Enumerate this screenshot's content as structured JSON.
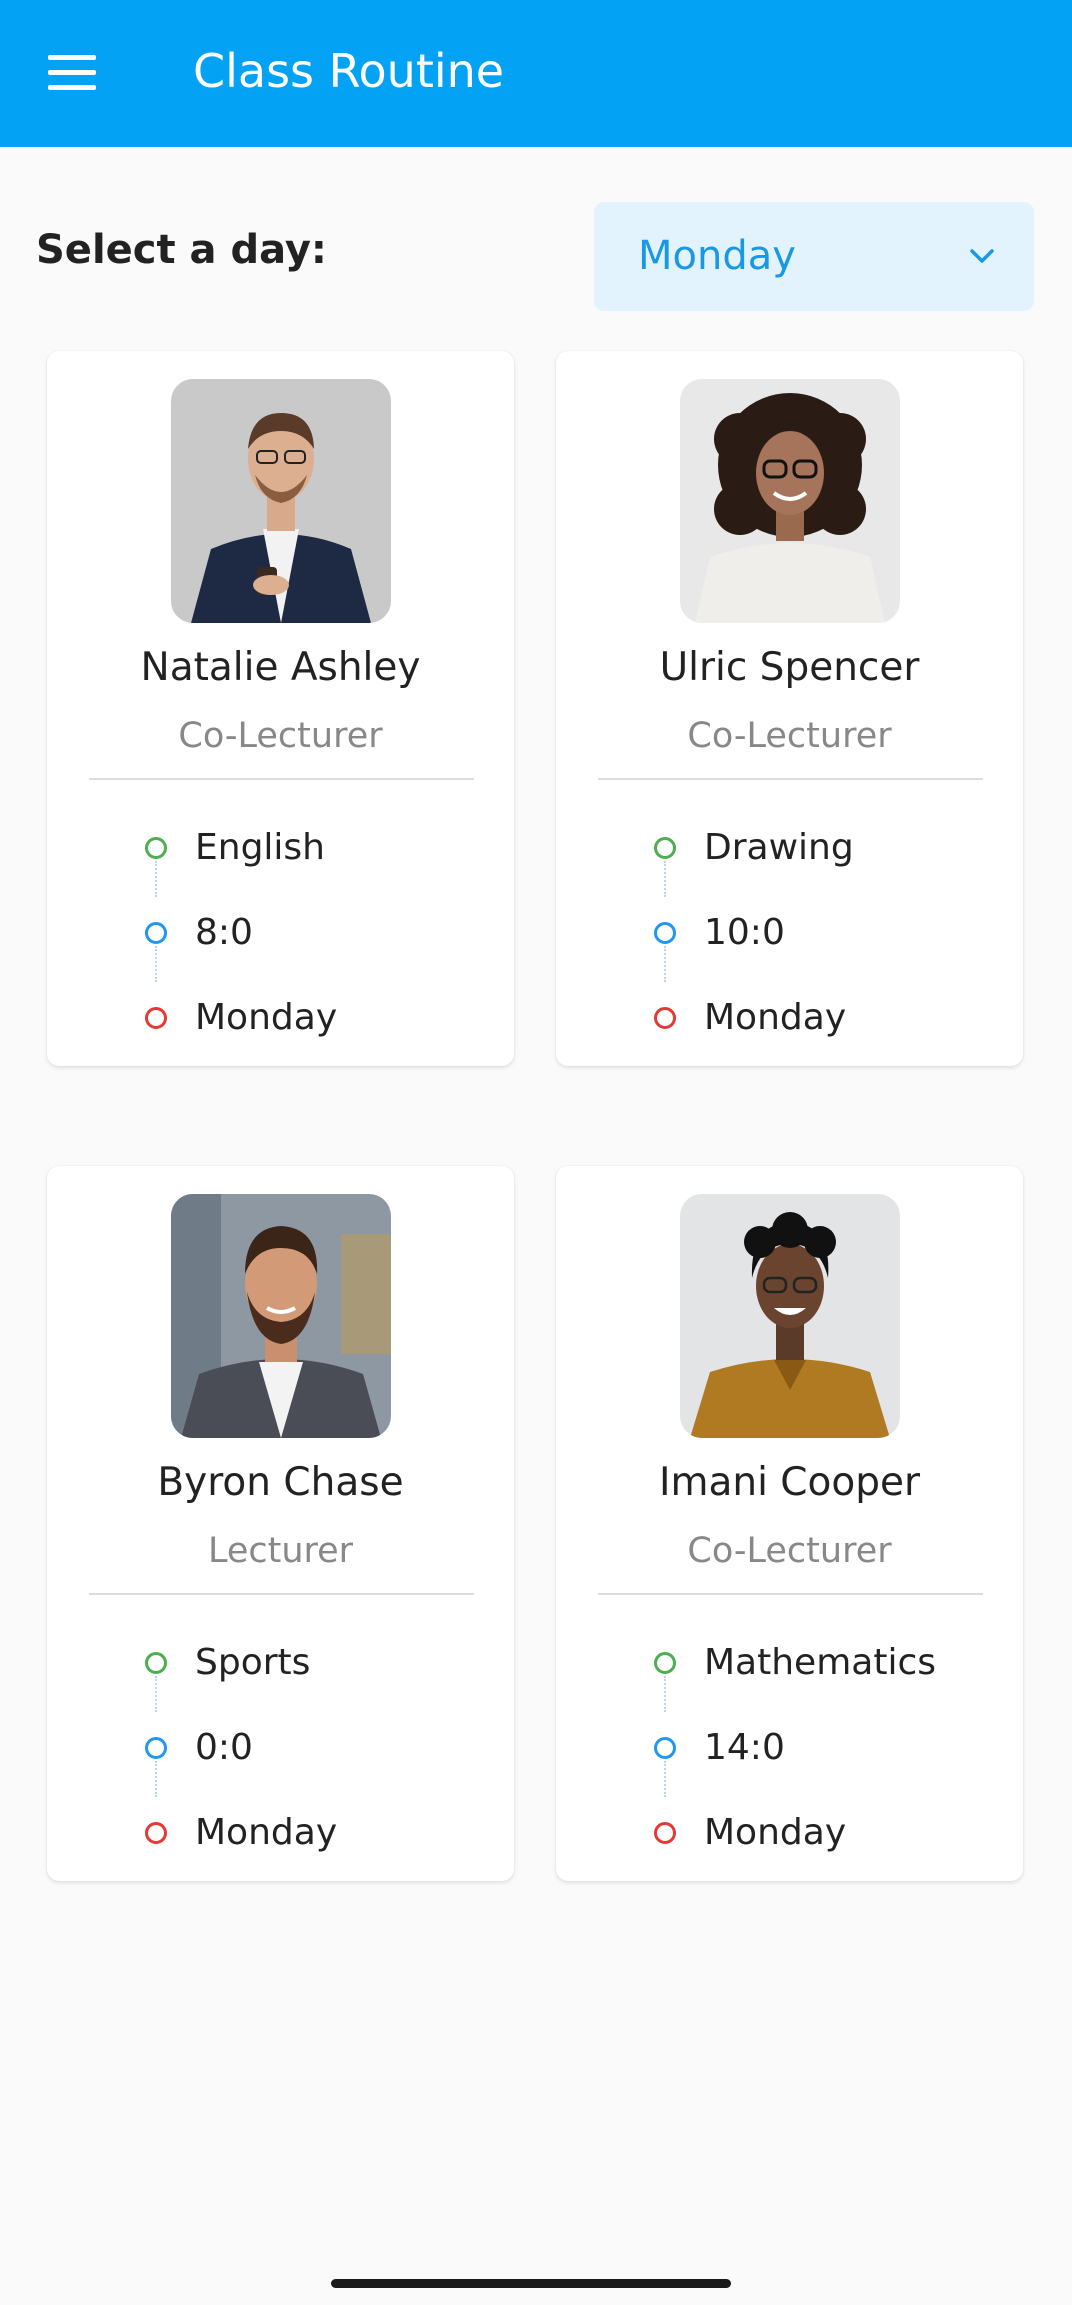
{
  "appbar": {
    "title": "Class Routine",
    "menu_icon": "hamburger-menu-icon",
    "background_color": "#03a2f5"
  },
  "day_selector": {
    "label": "Select a day:",
    "selected": "Monday",
    "icon": "chevron-down-icon"
  },
  "cards": [
    {
      "name": "Natalie Ashley",
      "role": "Co-Lecturer",
      "subject": "English",
      "time": "8:0",
      "day": "Monday"
    },
    {
      "name": "Ulric Spencer",
      "role": "Co-Lecturer",
      "subject": "Drawing",
      "time": "10:0",
      "day": "Monday"
    },
    {
      "name": "Byron Chase",
      "role": "Lecturer",
      "subject": "Sports",
      "time": "0:0",
      "day": "Monday"
    },
    {
      "name": "Imani Cooper",
      "role": "Co-Lecturer",
      "subject": "Mathematics",
      "time": "14:0",
      "day": "Monday"
    }
  ],
  "timeline_colors": {
    "subject": "#4caf50",
    "time": "#2196f3",
    "day": "#e53935"
  }
}
